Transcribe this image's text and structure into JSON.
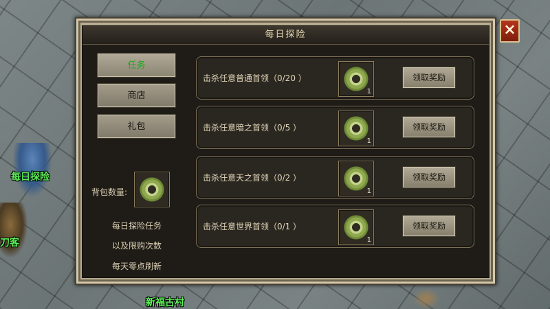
{
  "world": {
    "labels": {
      "daily": "每日探险",
      "blade": "刀客",
      "village": "新福古村"
    }
  },
  "window": {
    "title": "每日探险",
    "close_label": "×"
  },
  "sidebar": {
    "buttons": [
      {
        "label": "任务",
        "active": true
      },
      {
        "label": "商店",
        "active": false
      },
      {
        "label": "礼包",
        "active": false
      }
    ],
    "bag_label": "背包数量:",
    "bag_count": "",
    "description": [
      "每日探险任务",
      "以及限购次数",
      "每天零点刷新"
    ]
  },
  "tasks": [
    {
      "text": "击杀任意普通首领（0/20 ）",
      "reward_count": "1",
      "button": "领取奖励"
    },
    {
      "text": "击杀任意暗之首领（0/5 ）",
      "reward_count": "1",
      "button": "领取奖励"
    },
    {
      "text": "击杀任意天之首领（0/2 ）",
      "reward_count": "1",
      "button": "领取奖励"
    },
    {
      "text": "击杀任意世界首领（0/1 ）",
      "reward_count": "1",
      "button": "领取奖励"
    }
  ],
  "colors": {
    "active_tab": "#1fa81f",
    "world_label": "#5ef05a",
    "close_button": "#b5341c"
  },
  "icons": {
    "reward": "jade-disc-icon",
    "close": "close-icon"
  }
}
